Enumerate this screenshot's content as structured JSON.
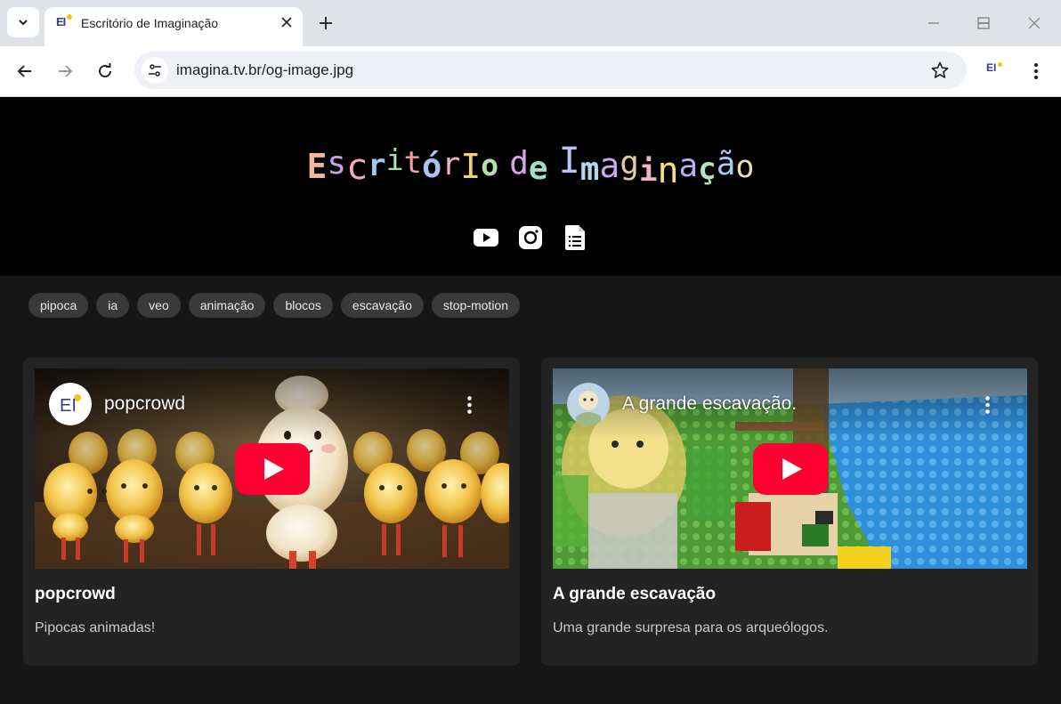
{
  "browser": {
    "tab_title": "Escritório de Imaginação",
    "favicon_text": "EI",
    "url": "imagina.tv.br/og-image.jpg",
    "extension_text": "EI"
  },
  "site": {
    "logo": [
      {
        "ch": "E",
        "color": "#f0b79a"
      },
      {
        "ch": "s",
        "color": "#c7a4e8"
      },
      {
        "ch": "c",
        "color": "#f5a6c0"
      },
      {
        "ch": "r",
        "color": "#9fc8ef"
      },
      {
        "ch": "i",
        "color": "#a8e6b0"
      },
      {
        "ch": "t",
        "color": "#f2a39a"
      },
      {
        "ch": "ó",
        "color": "#a8c4f0"
      },
      {
        "ch": "r",
        "color": "#f1b6c8"
      },
      {
        "ch": "I",
        "color": "#e9d47a"
      },
      {
        "ch": "o",
        "color": "#b7e0b0"
      },
      {
        "ch": " ",
        "color": "#ffffff"
      },
      {
        "ch": "d",
        "color": "#d9a6ee"
      },
      {
        "ch": "e",
        "color": "#9fe0c4"
      },
      {
        "ch": " ",
        "color": "#ffffff"
      },
      {
        "ch": "I",
        "color": "#b9c6f5"
      },
      {
        "ch": "m",
        "color": "#b3d7ef"
      },
      {
        "ch": "a",
        "color": "#c8a8f0"
      },
      {
        "ch": "g",
        "color": "#e2c9a0"
      },
      {
        "ch": "i",
        "color": "#f0b3c8"
      },
      {
        "ch": "n",
        "color": "#f3e27e"
      },
      {
        "ch": "a",
        "color": "#b8b0f0"
      },
      {
        "ch": "ç",
        "color": "#b7e2c0"
      },
      {
        "ch": "ã",
        "color": "#a8cdf2"
      },
      {
        "ch": "o",
        "color": "#e9dcb8"
      }
    ],
    "social_links": [
      "youtube-icon",
      "instagram-icon",
      "document-icon"
    ]
  },
  "tags": [
    "pipoca",
    "ia",
    "veo",
    "animação",
    "blocos",
    "escavação",
    "stop-motion"
  ],
  "cards": [
    {
      "video_title": "popcrowd",
      "channel_avatar_text": "EI",
      "title": "popcrowd",
      "description": "Pipocas animadas!"
    },
    {
      "video_title": "A grande escavação.",
      "title": "A grande escavação",
      "description": "Uma grande surpresa para os arqueólogos."
    }
  ],
  "colors": {
    "youtube_red": "#ff0033",
    "hero_bg": "#000000",
    "page_bg": "#161616",
    "card_bg": "#232323",
    "tag_bg": "#3a3a3a"
  }
}
